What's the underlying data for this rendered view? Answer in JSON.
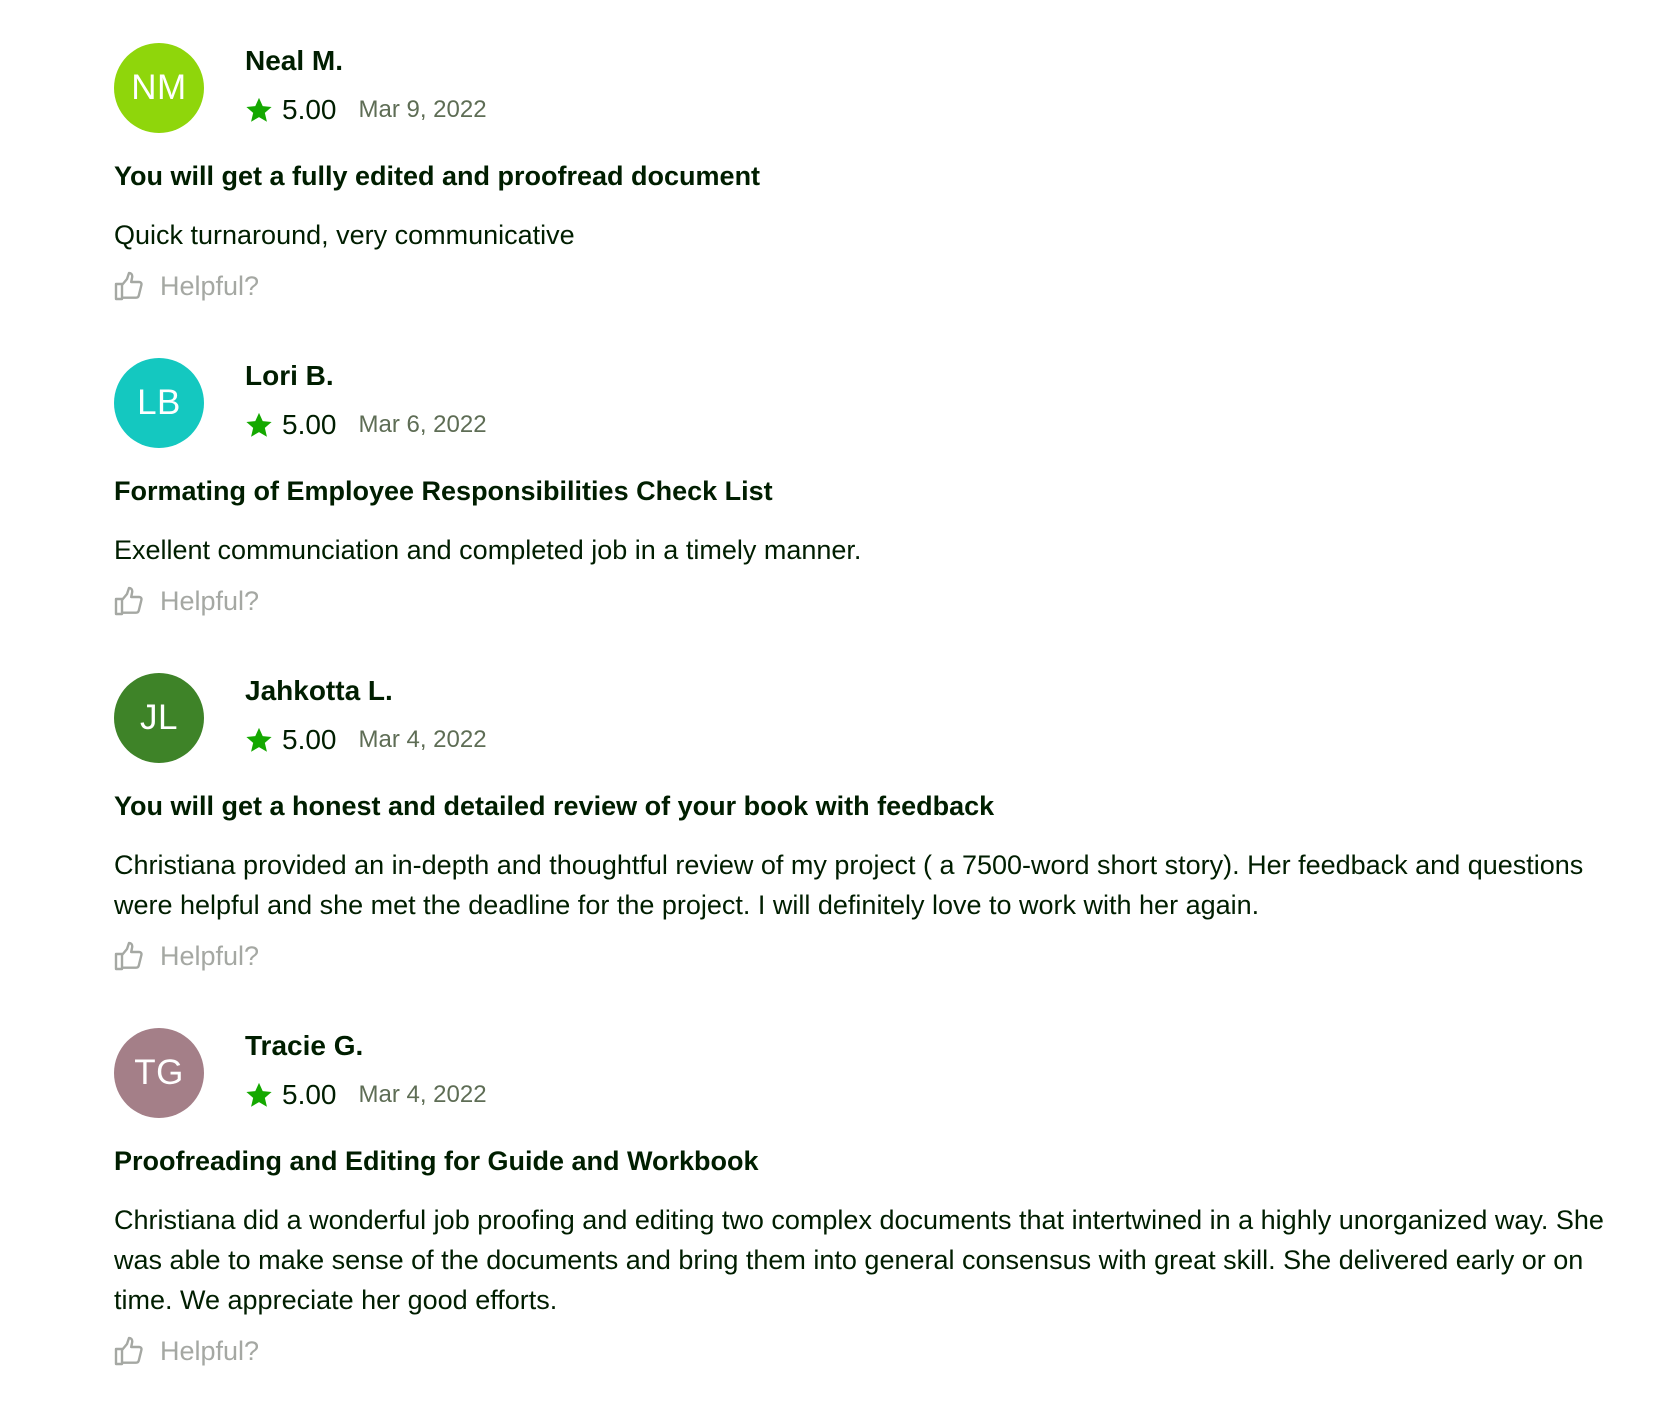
{
  "reviews": [
    {
      "initials": "NM",
      "avatar_color": "#8fd60b",
      "name": "Neal M.",
      "rating": "5.00",
      "date": "Mar 9, 2022",
      "job_title": "You will get a fully edited and proofread document",
      "text": "Quick turnaround, very communicative",
      "helpful_label": "Helpful?"
    },
    {
      "initials": "LB",
      "avatar_color": "#14c8c0",
      "name": "Lori B.",
      "rating": "5.00",
      "date": "Mar 6, 2022",
      "job_title": "Formating of Employee Responsibilities Check List",
      "text": "Exellent communciation and completed job in a timely manner.",
      "helpful_label": "Helpful?"
    },
    {
      "initials": "JL",
      "avatar_color": "#3e8328",
      "name": "Jahkotta L.",
      "rating": "5.00",
      "date": "Mar 4, 2022",
      "job_title": "You will get a honest and detailed review of your book with feedback",
      "text": "Christiana provided an in-depth and thoughtful review of my project ( a 7500-word short story). Her feedback and questions were helpful and she met the deadline for the project. I will definitely love to work with her again.",
      "helpful_label": "Helpful?"
    },
    {
      "initials": "TG",
      "avatar_color": "#a47f88",
      "name": "Tracie G.",
      "rating": "5.00",
      "date": "Mar 4, 2022",
      "job_title": "Proofreading and Editing for Guide and Workbook",
      "text": "Christiana did a wonderful job proofing and editing two complex documents that intertwined in a highly unorganized way. She was able to make sense of the documents and bring them into general consensus with great skill. She delivered early or on time. We appreciate her good efforts.",
      "helpful_label": "Helpful?"
    }
  ],
  "colors": {
    "star": "#14a800",
    "text": "#001e00",
    "date": "#5e6d55",
    "helpful": "#a5a8a3"
  },
  "icons": {
    "rating": "star-icon",
    "helpful": "thumbs-up-icon"
  }
}
